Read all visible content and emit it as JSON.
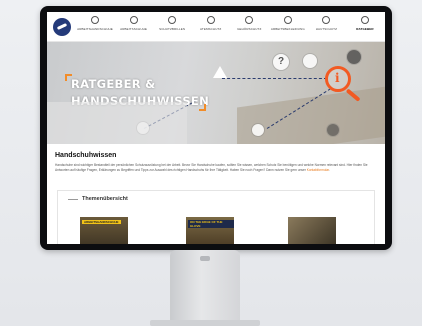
{
  "nav": {
    "items": [
      {
        "label": "ARBEITSHANDSCHUHE",
        "icon": "glove-icon"
      },
      {
        "label": "ARBEITSSCHUHE",
        "icon": "shoe-icon"
      },
      {
        "label": "SCHUTZBRILLEN",
        "icon": "glasses-icon"
      },
      {
        "label": "ATEMSCHUTZ",
        "icon": "mask-icon"
      },
      {
        "label": "GEHÖRSCHUTZ",
        "icon": "ear-icon"
      },
      {
        "label": "ARBEITSBEKLEIDUNG",
        "icon": "shirt-icon"
      },
      {
        "label": "HAUTSCHUTZ",
        "icon": "hand-icon"
      },
      {
        "label": "RATGEBER",
        "icon": "book-icon",
        "active": true
      }
    ]
  },
  "hero": {
    "title_line1": "RATGEBER &",
    "title_line2": "HANDSCHUHWISSEN",
    "question_mark": "?",
    "info_symbol": "i"
  },
  "content": {
    "title": "Handschuhwissen",
    "body_before": "Handschuhe sind wichtiger Bestandteil der persönlichen Schutzausrüstung bei der Arbeit. Bevor Sie Handschuhe kaufen, sollten Sie wissen, welchen Schutz Sie benötigen und welche Normen relevant sind. Hier finden Sie Antworten auf häufige Fragen, Erklärungen zu Begriffen und Tipps zur Auswahl des richtigen Handschuhs für Ihre Tätigkeit. Haben Sie noch Fragen? Dann nutzen Sie gern unser",
    "body_link": "Kontaktformular",
    "body_after": "."
  },
  "topics": {
    "title": "Themenübersicht",
    "items": [
      {
        "tag": "ARBEITSHANDSCHUHE"
      },
      {
        "tag": "ON THE EDGE OF THE GLOVE"
      },
      {
        "tag": ""
      }
    ]
  },
  "colors": {
    "accent_orange": "#f28c28",
    "magnifier_red": "#f25a22",
    "brand_blue": "#243a7a"
  }
}
